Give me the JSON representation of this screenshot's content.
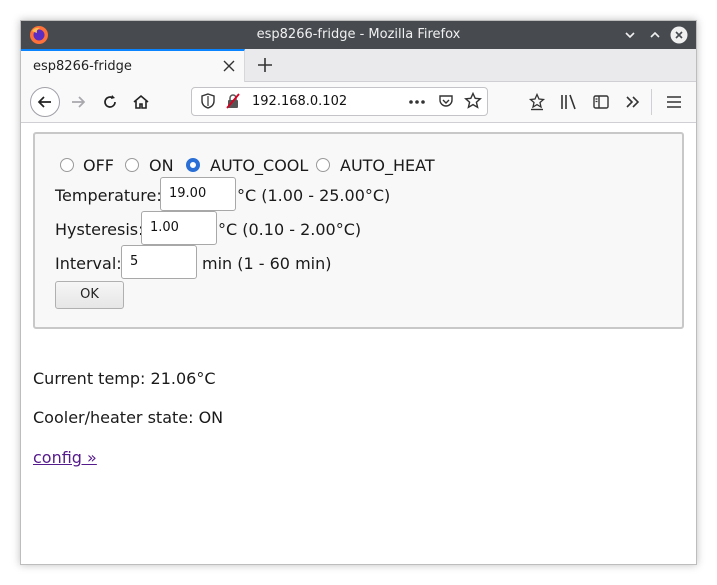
{
  "window": {
    "title": "esp8266-fridge - Mozilla Firefox"
  },
  "tab": {
    "title": "esp8266-fridge"
  },
  "address_bar": {
    "url": "192.168.0.102"
  },
  "form": {
    "modes": [
      {
        "label": "OFF",
        "checked": false
      },
      {
        "label": "ON",
        "checked": false
      },
      {
        "label": "AUTO_COOL",
        "checked": true
      },
      {
        "label": "AUTO_HEAT",
        "checked": false
      }
    ],
    "temperature": {
      "label": "Temperature:",
      "value": "19.00",
      "range": "°C (1.00 - 25.00°C)"
    },
    "hysteresis": {
      "label": "Hysteresis:",
      "value": "1.00",
      "range": "°C (0.10 - 2.00°C)"
    },
    "interval": {
      "label": "Interval:",
      "value": "5",
      "range": "min (1 - 60 min)"
    },
    "ok_label": "OK"
  },
  "status": {
    "current_temp": "Current temp: 21.06°C",
    "state": "Cooler/heater state: ON"
  },
  "link": {
    "config": "config »"
  },
  "colors": {
    "accent": "#0a84ff",
    "link_visited": "#551a8b",
    "titlebar": "#474b50"
  }
}
